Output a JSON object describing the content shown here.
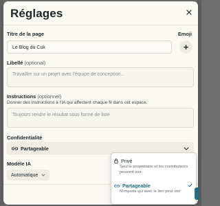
{
  "dialog": {
    "title": "Réglages",
    "close_icon": "close-icon"
  },
  "fields": {
    "page_title_label": "Titre de la page",
    "page_title_value": "Le Blog du Cuk",
    "emoji_label": "Emoji",
    "emoji_button": "+",
    "description_label": "Libellé",
    "description_optional": "(optional)",
    "description_placeholder": "Travailler sur un projet avec l'équipe de conception...",
    "instructions_label": "Instructions",
    "instructions_optional": "(optionnel)",
    "instructions_help": "Donner des instructions à l'IA qui affectent chaque fil dans cet espace.",
    "instructions_placeholder": "Toujours rendre le résultat sous forme de liste"
  },
  "privacy": {
    "label": "Confidentialité",
    "selected": "Partageable",
    "options": [
      {
        "label": "Privé",
        "description": "Seul le propriétaire et les contributeurs peuvent voir",
        "icon": "lock-icon"
      },
      {
        "label": "Partageable",
        "description": "N'importe qui avec le lien peut voir",
        "icon": "link-icon",
        "selected": true
      }
    ]
  },
  "model": {
    "label": "Modèle IA",
    "selected": "Automatique"
  },
  "colors": {
    "accent": "#1c6a83",
    "background": "#fbf9f4"
  }
}
